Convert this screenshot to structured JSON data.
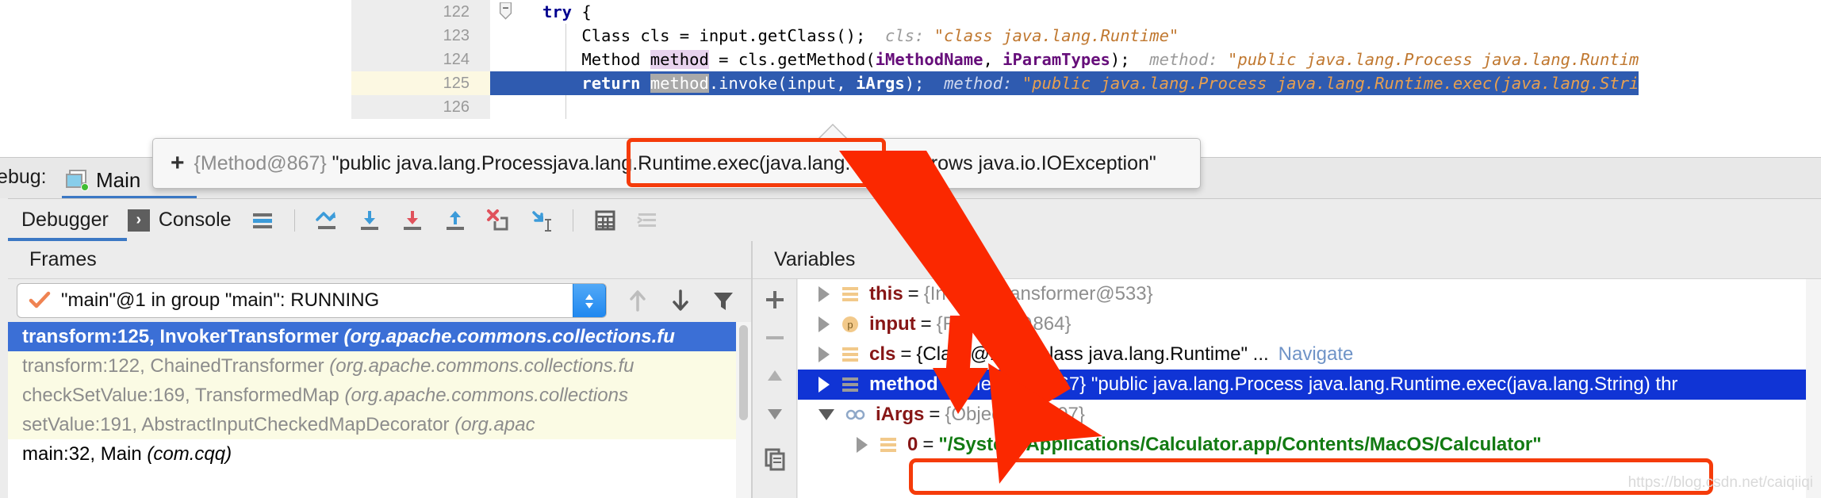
{
  "editor": {
    "lines": [
      {
        "num": "122",
        "text": "try {",
        "state": "normal"
      },
      {
        "num": "123",
        "text": "Class cls = input.getClass();",
        "inlay_label": "cls:",
        "inlay_value": "\"class java.lang.Runtime\"",
        "state": "normal"
      },
      {
        "num": "124",
        "text": "Method method = cls.getMethod(iMethodName, iParamTypes);",
        "inlay_label": "method:",
        "inlay_value": "\"public java.lang.Process java.lang.Runtim",
        "state": "normal"
      },
      {
        "num": "125",
        "text": "return method.invoke(input, iArgs);",
        "inlay_label": "method:",
        "inlay_value": "\"public java.lang.Process java.lang.Runtime.exec(java.lang.Stri",
        "state": "selected"
      },
      {
        "num": "126",
        "text": "",
        "state": "partial"
      }
    ],
    "line122_keyword": "try",
    "line122_rest": " {",
    "line123_pre": "Class cls = input.getClass();",
    "line124_pre": "Method ",
    "line124_method": "method",
    "line124_mid": " = cls.getMethod(",
    "line124_p1": "iMethodName",
    "line124_comma": ", ",
    "line124_p2": "iParamTypes",
    "line124_post": ");",
    "line125_kw": "return",
    "line125_method": "method",
    "line125_mid": ".invoke(input, ",
    "line125_arg": "iArgs",
    "line125_post": ");"
  },
  "tooltip": {
    "plus": "+",
    "ref": "{Method@867}",
    "text_before": "\"public java.lang.Process ",
    "highlight": "java.lang.Runtime.exec",
    "text_after": "(java.lang.String) throws java.io.IOException\""
  },
  "debug_window": {
    "label": "Debug:",
    "tab_title": "Main",
    "tab_close": "×",
    "toolbar": {
      "debugger_tab": "Debugger",
      "console_tab": "Console",
      "console_icon": "›",
      "buttons": [
        {
          "name": "show-execution-point",
          "title": "Show Execution Point"
        },
        {
          "name": "step-over",
          "title": "Step Over"
        },
        {
          "name": "step-into",
          "title": "Step Into"
        },
        {
          "name": "force-step-into",
          "title": "Force Step Into"
        },
        {
          "name": "step-out",
          "title": "Step Out"
        },
        {
          "name": "drop-frame",
          "title": "Drop Frame"
        },
        {
          "name": "run-to-cursor",
          "title": "Run to Cursor"
        },
        {
          "name": "evaluate-expression",
          "title": "Evaluate Expression"
        },
        {
          "name": "settings",
          "title": "Layout Settings"
        }
      ]
    }
  },
  "frames": {
    "header": "Frames",
    "thread_selector": {
      "value": "\"main\"@1 in group \"main\": RUNNING",
      "status_icon": "check-icon"
    },
    "nav": {
      "up": "↑",
      "down": "↓",
      "filter": "filter-icon"
    },
    "items": [
      {
        "main": "transform:125, InvokerTransformer ",
        "pkg": "(org.apache.commons.collections.fu",
        "state": "selected"
      },
      {
        "main": "transform:122, ChainedTransformer ",
        "pkg": "(org.apache.commons.collections.fu",
        "state": "library"
      },
      {
        "main": "checkSetValue:169, TransformedMap ",
        "pkg": "(org.apache.commons.collections",
        "state": "library"
      },
      {
        "main": "setValue:191, AbstractInputCheckedMapDecorator ",
        "pkg": "(org.apac",
        "state": "library"
      },
      {
        "main": "main:32, Main ",
        "pkg": "(com.cqq)",
        "state": "plain"
      }
    ]
  },
  "variables": {
    "header": "Variables",
    "gutter_buttons": [
      {
        "name": "add-watch-button",
        "glyph": "+"
      },
      {
        "name": "remove-watch-button",
        "glyph": "−"
      },
      {
        "name": "move-up-button",
        "glyph": "▲"
      },
      {
        "name": "move-down-button",
        "glyph": "▼"
      },
      {
        "name": "copy-value-button",
        "glyph": "copy-icon"
      }
    ],
    "rows": [
      {
        "name": "this",
        "eq": "=",
        "value": "{InvokerTransformer@533}",
        "icon": "field-icon",
        "twisty": "collapsed",
        "state": "normal",
        "indent": 0
      },
      {
        "name": "input",
        "eq": "=",
        "value": "{Runtime@864}",
        "icon": "parameter-icon",
        "twisty": "collapsed",
        "state": "normal",
        "indent": 0
      },
      {
        "name": "cls",
        "eq": "=",
        "value": "{Class@130} \"class java.lang.Runtime\" ...",
        "navigate": "Navigate",
        "icon": "field-icon",
        "twisty": "collapsed",
        "state": "normal",
        "indent": 0
      },
      {
        "name": "method",
        "eq": "=",
        "value": "{Method@867} \"public java.lang.Process java.lang.Runtime.exec(java.lang.String) thr",
        "icon": "field-icon",
        "twisty": "collapsed",
        "state": "selected",
        "indent": 0
      },
      {
        "name": "iArgs",
        "eq": "=",
        "value": "{Object[1]@807}",
        "icon": "array-icon",
        "twisty": "expanded",
        "state": "normal",
        "indent": 0
      },
      {
        "name": "0",
        "eq": "=",
        "value": "\"/System/Applications/Calculator.app/Contents/MacOS/Calculator\"",
        "icon": "field-icon",
        "twisty": "collapsed",
        "state": "string",
        "indent": 1
      }
    ]
  },
  "watermark": "https://blog.csdn.net/caiqiiqi",
  "colors": {
    "selection_blue": "#2f5bb0",
    "frame_selected": "#3b6fd6",
    "var_selected": "#1034d5",
    "red_annotation": "#f53b0a",
    "string_green": "#127a12",
    "accent_blue": "#3b78c4",
    "current_line": "#fcf8e2",
    "library_frame_bg": "#fbfbe4",
    "inlay_gray": "#9a9a9a",
    "inlay_value": "#c07830",
    "var_name_red": "#871616"
  }
}
